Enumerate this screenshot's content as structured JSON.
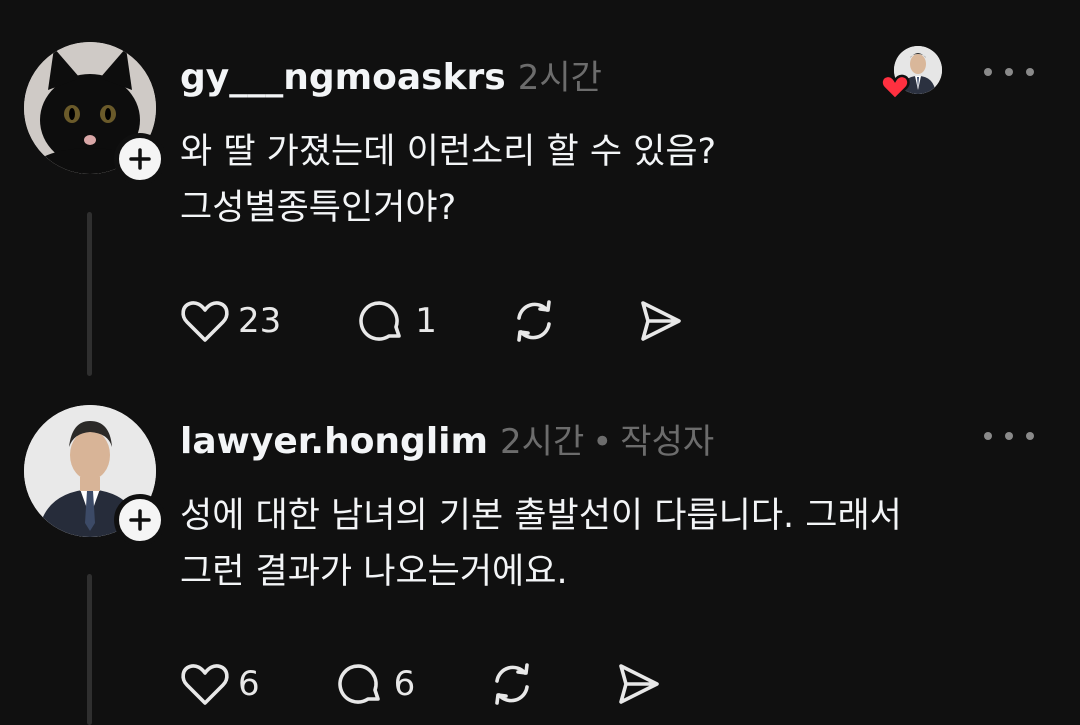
{
  "colors": {
    "background": "#101010",
    "text_primary": "#f3f5f7",
    "text_secondary": "#6c6c6c",
    "like_heart": "#ff3040"
  },
  "comments": [
    {
      "username": "gy___ngmoaskrs",
      "time": "2시간",
      "author_tag": "",
      "avatar_icon": "black-cat-avatar",
      "text_lines": [
        "와 딸 가졌는데 이런소리 할 수 있음?",
        "그성별종특인거야?"
      ],
      "likes": "23",
      "replies": "1",
      "liked_by_author": true
    },
    {
      "username": "lawyer.honglim",
      "time": "2시간",
      "separator": "•",
      "author_tag": "작성자",
      "avatar_icon": "man-in-suit-avatar",
      "text_lines": [
        "성에 대한 남녀의 기본 출발선이 다릅니다. 그래서",
        "그런 결과가 나오는거에요."
      ],
      "likes": "6",
      "replies": "6"
    }
  ]
}
